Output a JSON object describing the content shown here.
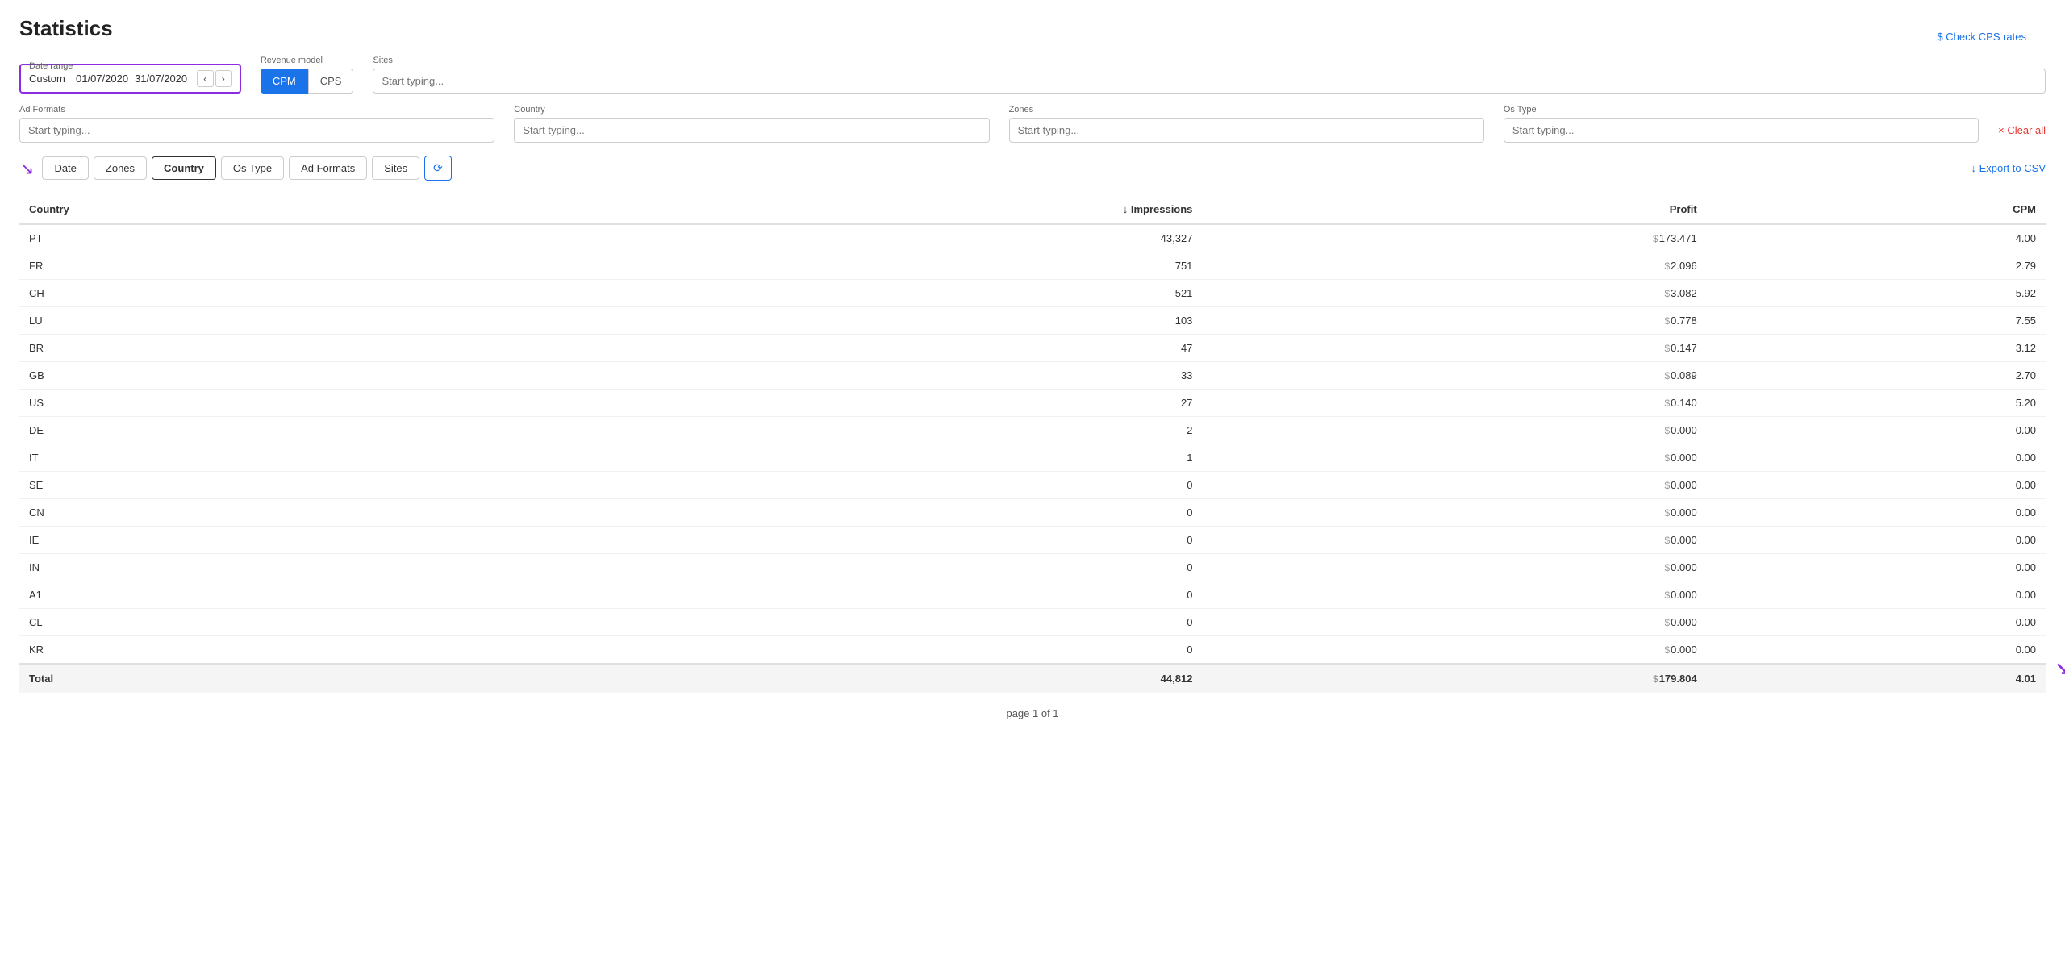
{
  "page": {
    "title": "Statistics",
    "check_cps_label": "$ Check CPS rates"
  },
  "filters": {
    "date_range": {
      "label": "Date range",
      "type": "Custom",
      "start": "01/07/2020",
      "end": "31/07/2020"
    },
    "revenue_model": {
      "label": "Revenue model",
      "options": [
        "CPM",
        "CPS"
      ],
      "active": "CPM"
    },
    "sites": {
      "label": "Sites",
      "placeholder": "Start typing..."
    },
    "ad_formats": {
      "label": "Ad Formats",
      "placeholder": "Start typing..."
    },
    "country": {
      "label": "Country",
      "placeholder": "Start typing..."
    },
    "zones": {
      "label": "Zones",
      "placeholder": "Start typing..."
    },
    "os_type": {
      "label": "Os Type",
      "placeholder": "Start typing..."
    },
    "clear_all_label": "× Clear all"
  },
  "tabs": {
    "items": [
      "Date",
      "Zones",
      "Country",
      "Os Type",
      "Ad Formats",
      "Sites"
    ],
    "active": "Country"
  },
  "export_label": "↓ Export to CSV",
  "table": {
    "columns": [
      "Country",
      "Impressions",
      "Profit",
      "CPM"
    ],
    "impressions_sort": "↓",
    "rows": [
      {
        "country": "PT",
        "impressions": "43,327",
        "profit": "173.471",
        "cpm": "4.00"
      },
      {
        "country": "FR",
        "impressions": "751",
        "profit": "2.096",
        "cpm": "2.79"
      },
      {
        "country": "CH",
        "impressions": "521",
        "profit": "3.082",
        "cpm": "5.92"
      },
      {
        "country": "LU",
        "impressions": "103",
        "profit": "0.778",
        "cpm": "7.55"
      },
      {
        "country": "BR",
        "impressions": "47",
        "profit": "0.147",
        "cpm": "3.12"
      },
      {
        "country": "GB",
        "impressions": "33",
        "profit": "0.089",
        "cpm": "2.70"
      },
      {
        "country": "US",
        "impressions": "27",
        "profit": "0.140",
        "cpm": "5.20"
      },
      {
        "country": "DE",
        "impressions": "2",
        "profit": "0.000",
        "cpm": "0.00"
      },
      {
        "country": "IT",
        "impressions": "1",
        "profit": "0.000",
        "cpm": "0.00"
      },
      {
        "country": "SE",
        "impressions": "0",
        "profit": "0.000",
        "cpm": "0.00"
      },
      {
        "country": "CN",
        "impressions": "0",
        "profit": "0.000",
        "cpm": "0.00"
      },
      {
        "country": "IE",
        "impressions": "0",
        "profit": "0.000",
        "cpm": "0.00"
      },
      {
        "country": "IN",
        "impressions": "0",
        "profit": "0.000",
        "cpm": "0.00"
      },
      {
        "country": "A1",
        "impressions": "0",
        "profit": "0.000",
        "cpm": "0.00"
      },
      {
        "country": "CL",
        "impressions": "0",
        "profit": "0.000",
        "cpm": "0.00"
      },
      {
        "country": "KR",
        "impressions": "0",
        "profit": "0.000",
        "cpm": "0.00"
      }
    ],
    "total": {
      "label": "Total",
      "impressions": "44,812",
      "profit": "179.804",
      "cpm": "4.01"
    }
  },
  "pagination": {
    "label": "page 1 of 1"
  }
}
